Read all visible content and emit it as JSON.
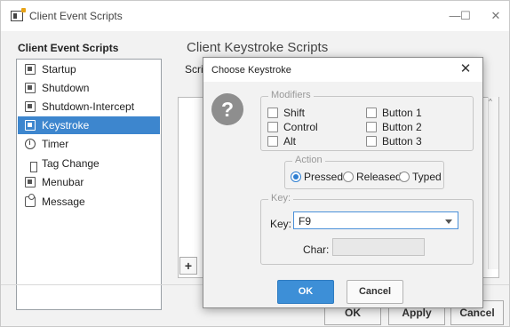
{
  "window": {
    "title": "Client Event Scripts",
    "minimize_symbol": "—",
    "maximize_symbol": "☐",
    "close_symbol": "✕"
  },
  "sidebar": {
    "title": "Client Event Scripts",
    "items": [
      {
        "label": "Startup",
        "icon": "startup-icon",
        "selected": false
      },
      {
        "label": "Shutdown",
        "icon": "shutdown-icon",
        "selected": false
      },
      {
        "label": "Shutdown-Intercept",
        "icon": "shutdown-intercept-icon",
        "selected": false
      },
      {
        "label": "Keystroke",
        "icon": "keystroke-icon",
        "selected": true
      },
      {
        "label": "Timer",
        "icon": "timer-icon",
        "selected": false
      },
      {
        "label": "Tag Change",
        "icon": "tag-change-icon",
        "selected": false
      },
      {
        "label": "Menubar",
        "icon": "menubar-icon",
        "selected": false
      },
      {
        "label": "Message",
        "icon": "message-icon",
        "selected": false
      }
    ]
  },
  "main": {
    "title": "Client Keystroke Scripts",
    "subtitle_partial": "Scrip",
    "add_label": "+",
    "scroll_up": "^",
    "scroll_right": ">"
  },
  "footer": {
    "ok_label": "OK",
    "apply_label": "Apply",
    "cancel_label": "Cancel"
  },
  "dialog": {
    "title": "Choose Keystroke",
    "close_symbol": "✕",
    "question_symbol": "?",
    "modifiers": {
      "legend": "Modifiers",
      "options": [
        {
          "label": "Shift",
          "checked": false
        },
        {
          "label": "Button 1",
          "checked": false
        },
        {
          "label": "Control",
          "checked": false
        },
        {
          "label": "Button 2",
          "checked": false
        },
        {
          "label": "Alt",
          "checked": false
        },
        {
          "label": "Button 3",
          "checked": false
        }
      ]
    },
    "action": {
      "legend": "Action",
      "options": [
        {
          "label": "Pressed",
          "selected": true
        },
        {
          "label": "Released",
          "selected": false
        },
        {
          "label": "Typed",
          "selected": false
        }
      ]
    },
    "key": {
      "legend": "Key:",
      "key_label": "Key:",
      "key_value": "F9",
      "char_label": "Char:",
      "char_value": ""
    },
    "ok_label": "OK",
    "cancel_label": "Cancel"
  },
  "colors": {
    "accent": "#3d86ce",
    "ok_button": "#3d8fd7"
  }
}
